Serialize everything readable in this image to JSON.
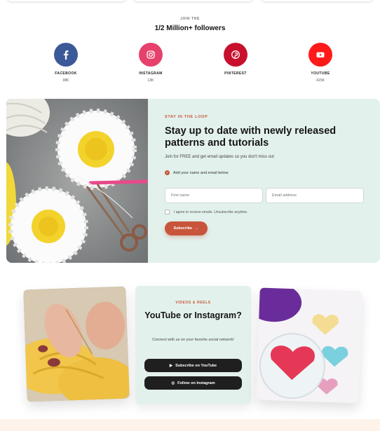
{
  "social": {
    "kicker": "JOIN THE",
    "title": "1/2 Million+ followers",
    "items": [
      {
        "name": "FACEBOOK",
        "count": "98K",
        "icon": "facebook-icon",
        "color": "#3b5998"
      },
      {
        "name": "INSTAGRAM",
        "count": "13K",
        "icon": "instagram-icon",
        "color": "#e1306c"
      },
      {
        "name": "PINTEREST",
        "count": "",
        "icon": "pinterest-icon",
        "color": "#bd081c"
      },
      {
        "name": "YOUTUBE",
        "count": "415K",
        "icon": "youtube-icon",
        "color": "#ff0000"
      }
    ]
  },
  "newsletter": {
    "kicker": "STAY IN THE LOOP",
    "title": "Stay up to date with newly released patterns and tutorials",
    "subtitle": "Join for FREE and get email updates so you don't miss out",
    "step_label": "Add your name and email below",
    "first_name_placeholder": "First name",
    "email_placeholder": "Email address",
    "agree_label": "I agree to receive emails. Unsubscribe anytime.",
    "subscribe_label": "Subscribe",
    "accent": "#c8553b",
    "background": "#e3f1ec"
  },
  "videos": {
    "kicker": "VIDEOS & REELS",
    "title": "YouTube or Instagram?",
    "text": "Connect with us on your favorite social network!",
    "youtube_button": "Subscribe on YouTube",
    "instagram_button": "Follow on Instagram"
  }
}
